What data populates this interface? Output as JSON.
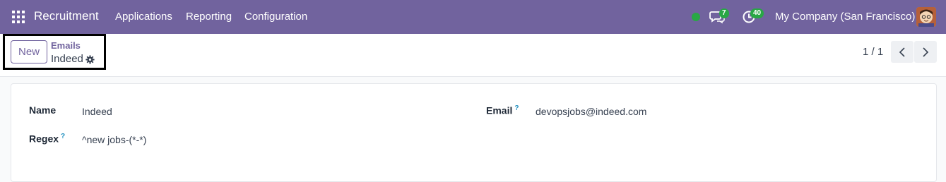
{
  "navbar": {
    "brand": "Recruitment",
    "menu": [
      "Applications",
      "Reporting",
      "Configuration"
    ],
    "messages_count": "7",
    "activities_count": "40",
    "company": "My Company (San Francisco)"
  },
  "control_panel": {
    "new_button": "New",
    "breadcrumb_parent": "Emails",
    "breadcrumb_current": "Indeed",
    "pager": "1 / 1"
  },
  "form": {
    "name_label": "Name",
    "name_value": "Indeed",
    "regex_label": "Regex",
    "regex_help": "?",
    "regex_value": "^new jobs-(*-*)",
    "email_label": "Email",
    "email_help": "?",
    "email_value": "devopsjobs@indeed.com"
  },
  "colors": {
    "navbar": "#71639e",
    "badge": "#28a745",
    "accent": "#71639e"
  },
  "icons": [
    "apps-grid-icon",
    "online-status-dot",
    "messages-icon",
    "activities-clock-icon",
    "user-avatar",
    "gear-icon",
    "chevron-left-icon",
    "chevron-right-icon"
  ]
}
